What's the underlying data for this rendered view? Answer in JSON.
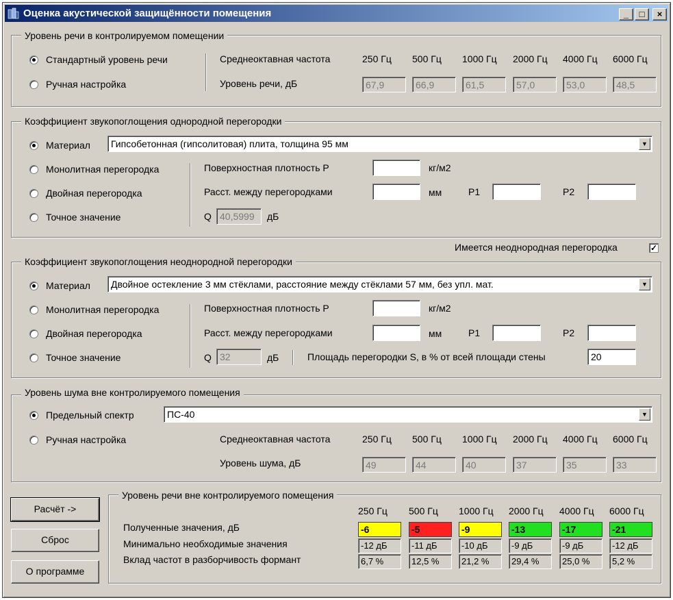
{
  "window": {
    "title": "Оценка акустической защищённости помещения",
    "minimize": "_",
    "maximize": "□",
    "close": "×"
  },
  "freq_label": "Среднеоктавная частота",
  "freqs": [
    "250 Гц",
    "500 Гц",
    "1000 Гц",
    "2000 Гц",
    "4000 Гц",
    "6000 Гц"
  ],
  "speech": {
    "legend": "Уровень речи в контролируемом помещении",
    "radio_standard": "Стандартный уровень речи",
    "radio_manual": "Ручная настройка",
    "level_label": "Уровень речи, дБ",
    "values": [
      "67,9",
      "66,9",
      "61,5",
      "57,0",
      "53,0",
      "48,5"
    ]
  },
  "homog": {
    "legend": "Коэффициент звукопоглощения однородной перегородки",
    "r_material": "Материал",
    "material": "Гипсобетонная (гипсолитовая) плита, толщина 95 мм",
    "r_mono": "Монолитная перегородка",
    "r_double": "Двойная перегородка",
    "r_exact": "Точное значение",
    "density_label": "Поверхностная плотность P",
    "density_unit": "кг/м2",
    "dist_label": "Расст. между перегородками",
    "dist_unit": "мм",
    "p1": "P1",
    "p2": "P2",
    "q_label": "Q",
    "q_value": "40,5999",
    "q_unit": "дБ"
  },
  "has_inhomog": "Имеется неоднородная перегородка",
  "inhomog": {
    "legend": "Коэффициент звукопоглощения неоднородной перегородки",
    "r_material": "Материал",
    "material": "Двойное остекление 3 мм стёклами, расстояние между стёклами 57 мм, без упл. мат.",
    "r_mono": "Монолитная перегородка",
    "r_double": "Двойная перегородка",
    "r_exact": "Точное значение",
    "density_label": "Поверхностная плотность P",
    "density_unit": "кг/м2",
    "dist_label": "Расст. между перегородками",
    "dist_unit": "мм",
    "p1": "P1",
    "p2": "P2",
    "q_label": "Q",
    "q_value": "32",
    "q_unit": "дБ",
    "area_label": "Площадь перегородки S, в % от всей площади стены",
    "area_value": "20"
  },
  "noise": {
    "legend": "Уровень шума вне контролируемого помещения",
    "r_spectrum": "Предельный спектр",
    "spectrum": "ПС-40",
    "r_manual": "Ручная настройка",
    "level_label": "Уровень шума, дБ",
    "values": [
      "49",
      "44",
      "40",
      "37",
      "35",
      "33"
    ]
  },
  "buttons": {
    "calc": "Расчёт ->",
    "reset": "Сброс",
    "about": "О программе"
  },
  "result": {
    "legend": "Уровень речи вне контролируемого помещения",
    "row1_label": "Полученные значения, дБ",
    "row2_label": "Минимально необходимые значения",
    "row3_label": "Вклад частот в разборчивость формант",
    "obtained": [
      "-6",
      "-5",
      "-9",
      "-13",
      "-17",
      "-21"
    ],
    "obtained_colors": [
      "#ffff00",
      "#ff2020",
      "#ffff00",
      "#20e020",
      "#20e020",
      "#20e020"
    ],
    "minimum": [
      "-12 дБ",
      "-11 дБ",
      "-10 дБ",
      "-9 дБ",
      "-9 дБ",
      "-12 дБ"
    ],
    "contribution": [
      "6,7 %",
      "12,5 %",
      "21,2 %",
      "29,4 %",
      "25,0 %",
      "5,2 %"
    ]
  }
}
